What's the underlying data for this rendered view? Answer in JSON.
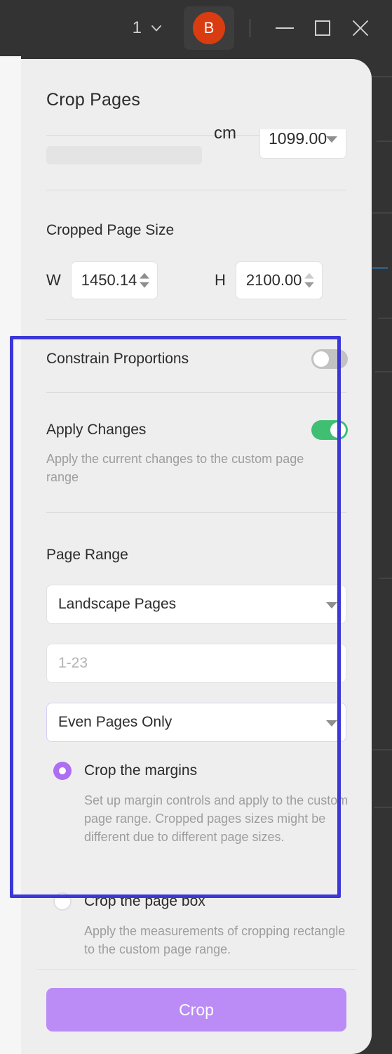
{
  "titlebar": {
    "page_number": "1",
    "chevron_icon": "chevron-down-icon",
    "avatar_initial": "B",
    "avatar_color": "#da3c12",
    "minimize_label": "—",
    "maximize_label": "□",
    "close_label": "✕"
  },
  "panel": {
    "title": "Crop Pages",
    "scrolled_row": {
      "unit_label": "cm",
      "value": "1099.00",
      "caret_icon": "caret-down-icon"
    },
    "cropped_page_size": {
      "section_label": "Cropped Page Size",
      "width_letter": "W",
      "width_value": "1450.14",
      "height_letter": "H",
      "height_value": "2100.00",
      "stepper_up_icon": "stepper-up-icon",
      "stepper_down_icon": "stepper-down-icon"
    },
    "constrain_proportions": {
      "label": "Constrain Proportions",
      "state": "off",
      "off_color": "#c3c2c3"
    },
    "apply_changes": {
      "label": "Apply Changes",
      "description": "Apply the current changes to the custom page range",
      "state": "on",
      "on_color": "#3fbf72"
    },
    "page_range": {
      "section_label": "Page Range",
      "scope_select_value": "Landscape Pages",
      "range_input_value": "",
      "range_input_placeholder": "1-23",
      "parity_select_value": "Even Pages Only",
      "caret_icon": "caret-down-icon"
    },
    "crop_mode": {
      "options": [
        {
          "label": "Crop the margins",
          "description": "Set up margin controls and apply to the custom page range. Cropped pages sizes might be different due to different page sizes.",
          "selected": true
        },
        {
          "label": "Crop the page box",
          "description": "Apply the measurements of cropping rectangle to the custom page range.",
          "selected": false
        }
      ],
      "selected_color": "#ad6ef2"
    },
    "crop_button": {
      "label": "Crop",
      "color": "#bb8cf6"
    },
    "highlight_border_color": "#3b37d8"
  }
}
